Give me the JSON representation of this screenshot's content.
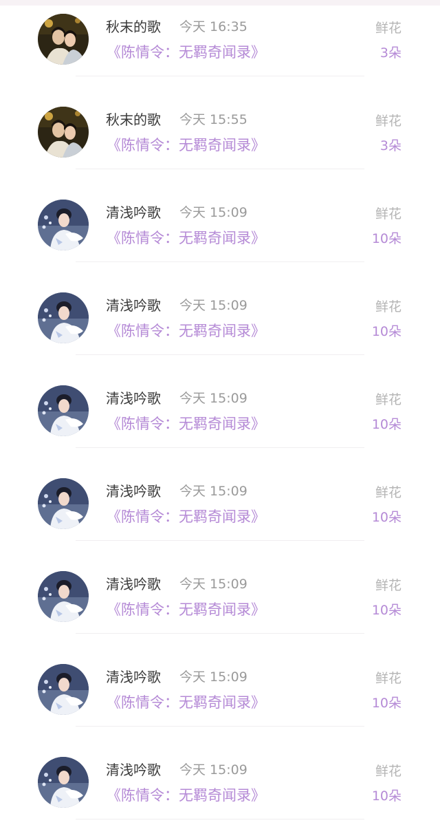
{
  "gift_list": {
    "entries": [
      {
        "user": "秋末的歌",
        "time": "今天 16:35",
        "book": "《陈情令：无羁奇闻录》",
        "gift": "鲜花",
        "count": "3朵",
        "avatar": "couple-portrait"
      },
      {
        "user": "秋末的歌",
        "time": "今天 15:55",
        "book": "《陈情令：无羁奇闻录》",
        "gift": "鲜花",
        "count": "3朵",
        "avatar": "couple-portrait"
      },
      {
        "user": "清浅吟歌",
        "time": "今天 15:09",
        "book": "《陈情令：无羁奇闻录》",
        "gift": "鲜花",
        "count": "10朵",
        "avatar": "lady-in-white-fur"
      },
      {
        "user": "清浅吟歌",
        "time": "今天 15:09",
        "book": "《陈情令：无羁奇闻录》",
        "gift": "鲜花",
        "count": "10朵",
        "avatar": "lady-in-white-fur"
      },
      {
        "user": "清浅吟歌",
        "time": "今天 15:09",
        "book": "《陈情令：无羁奇闻录》",
        "gift": "鲜花",
        "count": "10朵",
        "avatar": "lady-in-white-fur"
      },
      {
        "user": "清浅吟歌",
        "time": "今天 15:09",
        "book": "《陈情令：无羁奇闻录》",
        "gift": "鲜花",
        "count": "10朵",
        "avatar": "lady-in-white-fur"
      },
      {
        "user": "清浅吟歌",
        "time": "今天 15:09",
        "book": "《陈情令：无羁奇闻录》",
        "gift": "鲜花",
        "count": "10朵",
        "avatar": "lady-in-white-fur"
      },
      {
        "user": "清浅吟歌",
        "time": "今天 15:09",
        "book": "《陈情令：无羁奇闻录》",
        "gift": "鲜花",
        "count": "10朵",
        "avatar": "lady-in-white-fur"
      },
      {
        "user": "清浅吟歌",
        "time": "今天 15:09",
        "book": "《陈情令：无羁奇闻录》",
        "gift": "鲜花",
        "count": "10朵",
        "avatar": "lady-in-white-fur"
      }
    ]
  },
  "colors": {
    "accent": "#b58ad6",
    "name": "#3a3a3a",
    "muted": "#9a9a9a"
  }
}
